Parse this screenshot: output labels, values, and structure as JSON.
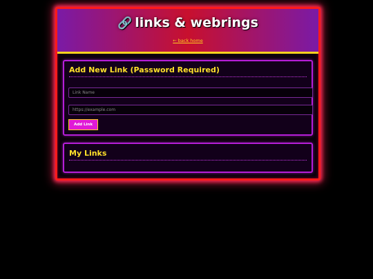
{
  "header": {
    "title_icon": "🔗",
    "title": "links & webrings",
    "back_link": "← back home"
  },
  "add_section": {
    "title": "Add New Link (Password Required)",
    "name_placeholder": "Link Name",
    "url_placeholder": "https://example.com",
    "submit_label": "Add Link"
  },
  "links_section": {
    "title": "My Links",
    "items": []
  },
  "colors": {
    "frame_border": "#ff1a1a",
    "header_gradient_start": "#7a1aa6",
    "header_gradient_mid": "#c8102e",
    "accent_yellow": "#ffd21f",
    "panel_border": "#b61ed8",
    "button_bg": "#e01ad6"
  },
  "icons": {
    "title_icon": "link-chain-icon"
  }
}
